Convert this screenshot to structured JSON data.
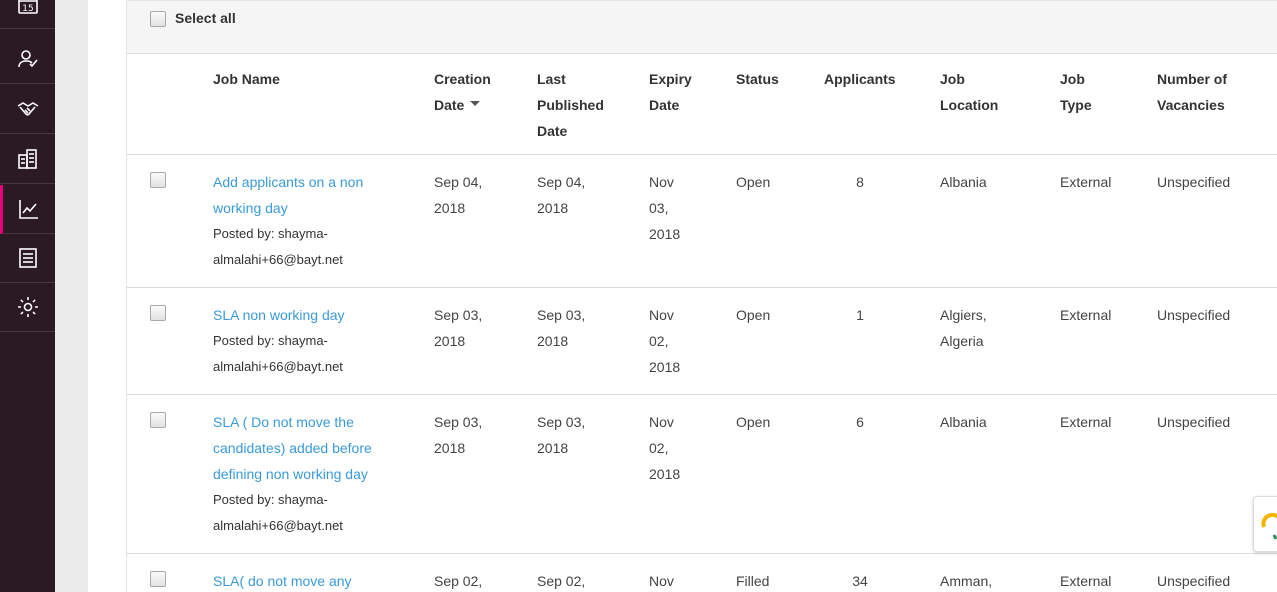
{
  "sidebar": {
    "items": [
      {
        "icon": "calendar-icon",
        "label": "15"
      },
      {
        "icon": "user-check-icon"
      },
      {
        "icon": "handshake-icon"
      },
      {
        "icon": "building-icon"
      },
      {
        "icon": "chart-line-icon",
        "active": true
      },
      {
        "icon": "document-icon"
      },
      {
        "icon": "gear-icon"
      }
    ],
    "accent": "#e6007e",
    "background": "#2b1a24"
  },
  "select_all": {
    "label": "Select all"
  },
  "table": {
    "headers": {
      "job_name": "Job Name",
      "creation_date_1": "Creation",
      "creation_date_2": "Date",
      "last_published_1": "Last",
      "last_published_2": "Published",
      "last_published_3": "Date",
      "expiry_1": "Expiry",
      "expiry_2": "Date",
      "status": "Status",
      "applicants": "Applicants",
      "job_location_1": "Job",
      "job_location_2": "Location",
      "job_type_1": "Job",
      "job_type_2": "Type",
      "vacancies_1": "Number of",
      "vacancies_2": "Vacancies"
    },
    "rows": [
      {
        "title_lines": [
          "Add applicants on a non",
          "working day"
        ],
        "posted_lines": [
          "Posted by: shayma-",
          "almalahi+66@bayt.net"
        ],
        "creation": [
          "Sep 04,",
          "2018"
        ],
        "published": [
          "Sep 04,",
          "2018"
        ],
        "expiry": [
          "Nov",
          "03,",
          "2018"
        ],
        "status": "Open",
        "applicants": "8",
        "location": [
          "Albania"
        ],
        "type": "External",
        "vacancies": "Unspecified"
      },
      {
        "title_lines": [
          "SLA non working day"
        ],
        "posted_lines": [
          "Posted by: shayma-",
          "almalahi+66@bayt.net"
        ],
        "creation": [
          "Sep 03,",
          "2018"
        ],
        "published": [
          "Sep 03,",
          "2018"
        ],
        "expiry": [
          "Nov",
          "02,",
          "2018"
        ],
        "status": "Open",
        "applicants": "1",
        "location": [
          "Algiers,",
          "Algeria"
        ],
        "type": "External",
        "vacancies": "Unspecified"
      },
      {
        "title_lines": [
          "SLA ( Do not move the",
          "candidates) added before",
          "defining non working day"
        ],
        "posted_lines": [
          "Posted by: shayma-",
          "almalahi+66@bayt.net"
        ],
        "creation": [
          "Sep 03,",
          "2018"
        ],
        "published": [
          "Sep 03,",
          "2018"
        ],
        "expiry": [
          "Nov",
          "02,",
          "2018"
        ],
        "status": "Open",
        "applicants": "6",
        "location": [
          "Albania"
        ],
        "type": "External",
        "vacancies": "Unspecified"
      },
      {
        "title_lines": [
          "SLA( do not move any"
        ],
        "posted_lines": [],
        "creation": [
          "Sep 02,"
        ],
        "published": [
          "Sep 02,"
        ],
        "expiry": [
          "Nov"
        ],
        "status": "Filled",
        "applicants": "34",
        "location": [
          "Amman,"
        ],
        "type": "External",
        "vacancies": "Unspecified"
      }
    ]
  },
  "colors": {
    "link": "#3a9ad9",
    "text": "#444444",
    "header": "#333333"
  }
}
